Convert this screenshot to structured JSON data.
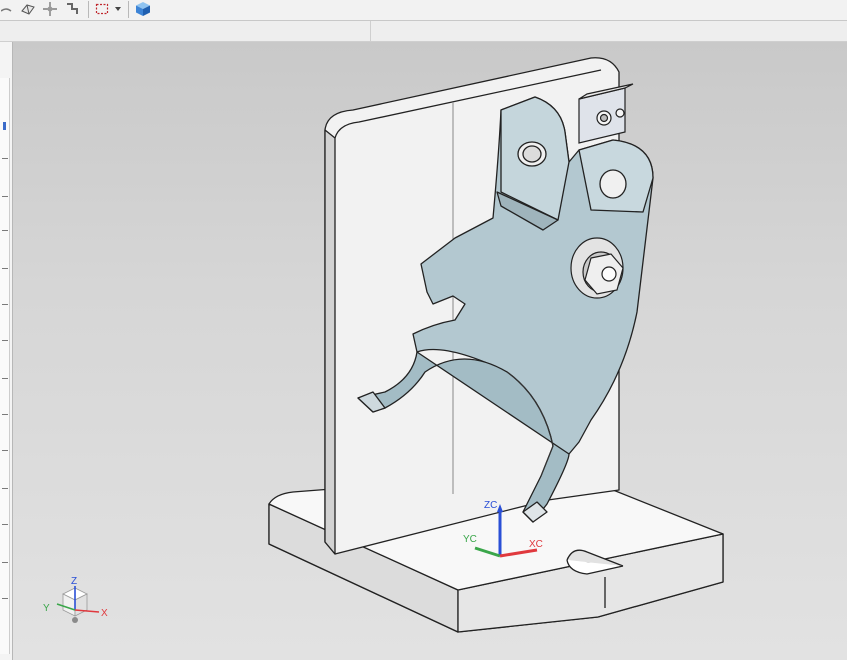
{
  "toolbar": {
    "buttons": [
      {
        "name": "partial-tool-icon"
      },
      {
        "name": "edge-blend-icon"
      },
      {
        "name": "move-point-icon"
      },
      {
        "name": "snap-point-icon"
      },
      {
        "name": "selection-box-icon"
      },
      {
        "name": "dropdown-arrow-icon"
      },
      {
        "name": "render-style-cube-icon"
      }
    ]
  },
  "viewport": {
    "csys_labels": {
      "z": "ZC",
      "y": "YC",
      "x": "XC"
    },
    "triad_labels": {
      "z": "Z",
      "y": "Y",
      "x": "X"
    },
    "colors": {
      "x_axis": "#e0393e",
      "y_axis": "#3aa64a",
      "z_axis": "#2a4fd6",
      "part_bracket": "#a9c1c9",
      "base_plate": "#f1f1f1"
    }
  }
}
